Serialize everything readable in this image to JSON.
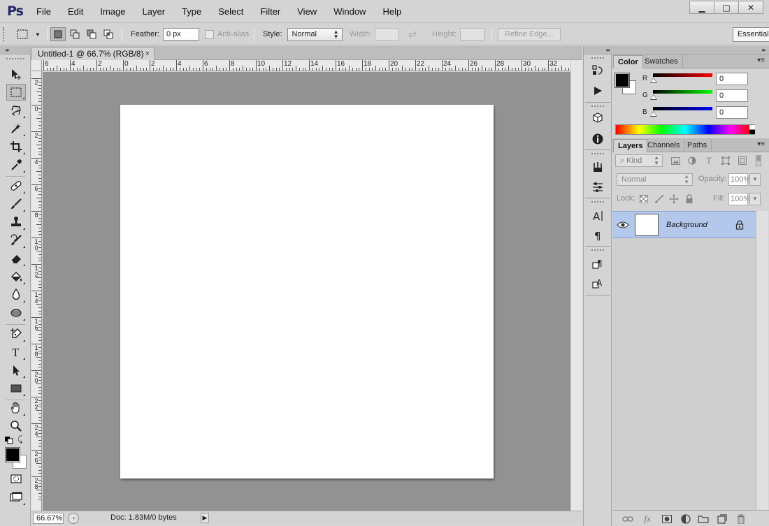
{
  "app": {
    "logo": "Ps"
  },
  "menu": [
    "File",
    "Edit",
    "Image",
    "Layer",
    "Type",
    "Select",
    "Filter",
    "View",
    "Window",
    "Help"
  ],
  "window_controls": {
    "minimize": "▁",
    "restore": "□",
    "close": "✕"
  },
  "options_bar": {
    "feather_label": "Feather:",
    "feather_value": "0 px",
    "antialias_label": "Anti-alias",
    "style_label": "Style:",
    "style_value": "Normal",
    "width_label": "Width:",
    "height_label": "Height:",
    "refine_edge": "Refine Edge...",
    "workspace": "Essentials"
  },
  "document": {
    "tab_title": "Untitled-1 @ 66.7% (RGB/8)",
    "tab_close": "×",
    "canvas_color": "#ffffff",
    "pasteboard_color": "#929292"
  },
  "ruler": {
    "horizontal": [
      "6",
      "4",
      "2",
      "0",
      "2",
      "4",
      "6",
      "8",
      "10",
      "12",
      "14",
      "16",
      "18",
      "20",
      "22",
      "24",
      "26",
      "28",
      "30",
      "32"
    ],
    "vertical": [
      "2",
      "0",
      "2",
      "4",
      "6",
      "8",
      "1\n0",
      "1\n2",
      "1\n4",
      "1\n6",
      "1\n8",
      "2\n0",
      "2\n2",
      "2\n4",
      "2\n6",
      "2\n8"
    ]
  },
  "status": {
    "zoom": "66.67%",
    "doc_size": "Doc: 1.83M/0 bytes",
    "arrow": "▶"
  },
  "tools": [
    "move",
    "marquee",
    "lasso",
    "quick-select",
    "crop",
    "eyedropper",
    "healing",
    "brush",
    "clone-stamp",
    "history-brush",
    "eraser",
    "paint-bucket",
    "blur",
    "dodge",
    "pen",
    "type",
    "path-select",
    "rectangle",
    "hand",
    "zoom"
  ],
  "color_panel": {
    "tabs": [
      "Color",
      "Swatches"
    ],
    "r_label": "R",
    "g_label": "G",
    "b_label": "B",
    "r_value": "0",
    "g_value": "0",
    "b_value": "0",
    "foreground": "#000000",
    "background": "#ffffff"
  },
  "layers_panel": {
    "tabs": [
      "Layers",
      "Channels",
      "Paths"
    ],
    "kind_label": "Kind",
    "blend_mode": "Normal",
    "opacity_label": "Opacity:",
    "opacity_value": "100%",
    "lock_label": "Lock:",
    "fill_label": "Fill:",
    "fill_value": "100%",
    "layer_name": "Background",
    "selected_color": "#b4c8ec"
  },
  "panel_collapse": "◂◂",
  "panel_expand": "▸▸"
}
